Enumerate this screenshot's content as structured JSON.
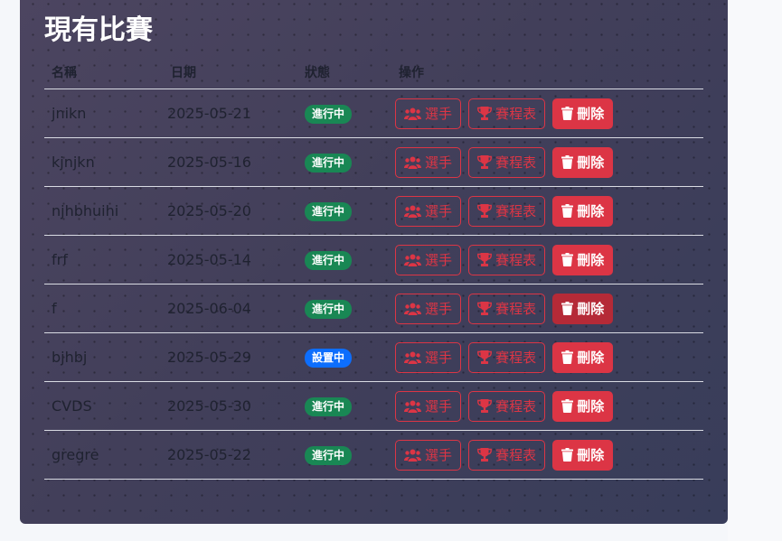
{
  "title": "現有比賽",
  "columns": {
    "name": "名稱",
    "date": "日期",
    "status": "狀態",
    "actions": "操作"
  },
  "buttons": {
    "players": "選手",
    "bracket": "賽程表",
    "delete": "刪除"
  },
  "status_colors": {
    "進行中": "#198754",
    "設置中": "#0d6efd"
  },
  "accent_color": "#dc3545",
  "tournaments": [
    {
      "name": "jnikn",
      "date": "2025-05-21",
      "status": "進行中"
    },
    {
      "name": "kjnjkn",
      "date": "2025-05-16",
      "status": "進行中"
    },
    {
      "name": "njhbhuihi",
      "date": "2025-05-20",
      "status": "進行中"
    },
    {
      "name": "frf",
      "date": "2025-05-14",
      "status": "進行中"
    },
    {
      "name": "f",
      "date": "2025-06-04",
      "status": "進行中",
      "delete_hover": true
    },
    {
      "name": "bjhbj",
      "date": "2025-05-29",
      "status": "設置中"
    },
    {
      "name": "CVDS",
      "date": "2025-05-30",
      "status": "進行中"
    },
    {
      "name": "gregre",
      "date": "2025-05-22",
      "status": "進行中"
    }
  ]
}
